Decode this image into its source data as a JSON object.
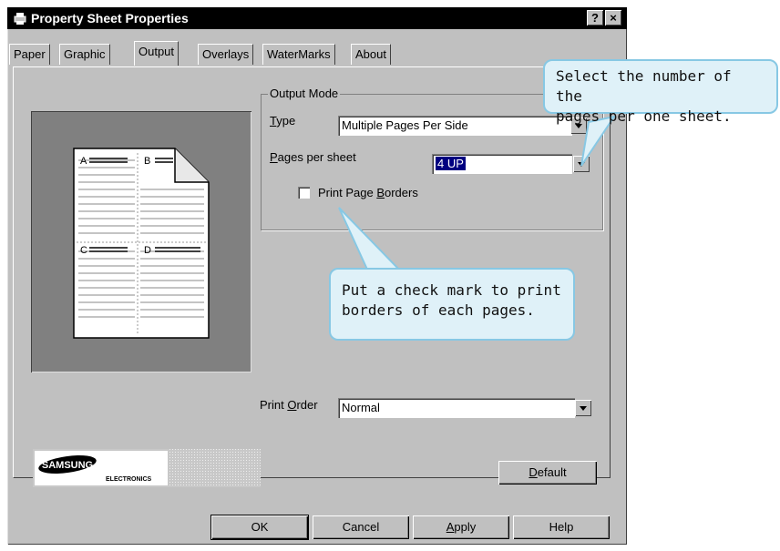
{
  "window": {
    "title": "Property Sheet Properties",
    "help_btn": "?",
    "close_btn": "×"
  },
  "tabs": [
    "Paper",
    "Graphic",
    "Output",
    "Overlays",
    "WaterMarks",
    "About"
  ],
  "preview": {
    "quadrants": [
      "A",
      "B",
      "C",
      "D"
    ]
  },
  "output_mode": {
    "group_label": "Output Mode",
    "type_label_key": "T",
    "type_label_rest": "ype",
    "type_value": "Multiple Pages Per Side",
    "pages_label_key": "P",
    "pages_label_rest": "ages per sheet",
    "pages_value": "4 UP",
    "print_borders_pre": "Print Page ",
    "print_borders_key": "B",
    "print_borders_post": "orders",
    "print_borders_checked": false
  },
  "print_order": {
    "label_pre": "Print ",
    "label_key": "O",
    "label_post": "rder",
    "value": "Normal"
  },
  "logo": {
    "brand": "SAMSUNG",
    "sub": "ELECTRONICS"
  },
  "buttons": {
    "default_key": "D",
    "default_rest": "efault",
    "ok": "OK",
    "cancel": "Cancel",
    "apply_key": "A",
    "apply_rest": "pply",
    "help": "Help"
  },
  "callouts": {
    "pages_note_1": "Select the number of the",
    "pages_note_2": "pages per one sheet.",
    "borders_note_1": "Put a check mark to print",
    "borders_note_2": "borders of each pages."
  },
  "colors": {
    "face": "#c0c0c0",
    "preview_bg": "#808080",
    "callout_fill": "#dff1f8",
    "callout_border": "#87c8e4",
    "selection": "#000080"
  }
}
